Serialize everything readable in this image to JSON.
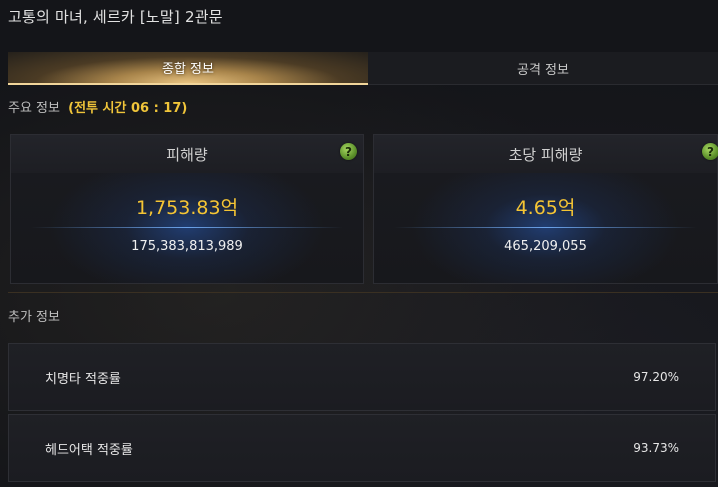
{
  "window": {
    "title": "고통의 마녀, 세르카 [노말] 2관문"
  },
  "tabs": [
    {
      "label": "종합 정보",
      "active": true
    },
    {
      "label": "공격 정보",
      "active": false
    }
  ],
  "main_info": {
    "label": "주요 정보",
    "combat_time": "(전투 시간 06 : 17)"
  },
  "cards": {
    "damage": {
      "title": "피해량",
      "value": "1,753.83억",
      "raw": "175,383,813,989",
      "help": "?"
    },
    "dps": {
      "title": "초당 피해량",
      "value": "4.65억",
      "raw": "465,209,055",
      "help": "?"
    }
  },
  "extra_info": {
    "label": "추가 정보",
    "rows": [
      {
        "name": "치명타 적중률",
        "value": "97.20%"
      },
      {
        "name": "헤드어택 적중률",
        "value": "93.73%"
      }
    ]
  },
  "colors": {
    "accent_gold": "#f5c534",
    "tab_active_glow": "#f1d59a",
    "help_icon": "#7fb83f"
  }
}
